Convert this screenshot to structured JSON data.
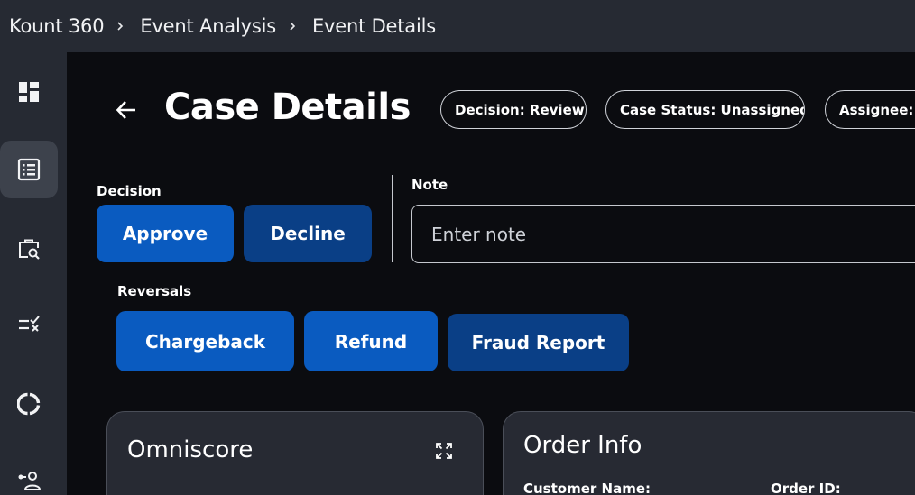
{
  "breadcrumb": {
    "items": [
      "Kount 360",
      "Event Analysis",
      "Event Details"
    ]
  },
  "sidebar": {
    "items": [
      {
        "icon": "dashboard-icon"
      },
      {
        "icon": "list-icon",
        "active": true
      },
      {
        "icon": "case-search-icon"
      },
      {
        "icon": "rules-check-icon"
      },
      {
        "icon": "donut-chart-icon"
      },
      {
        "icon": "user-flow-icon"
      }
    ]
  },
  "header": {
    "title": "Case Details",
    "pills": {
      "decision": "Decision: Review",
      "case_status": "Case Status: Unassigned",
      "assignee": "Assignee: Unassigned"
    }
  },
  "decision": {
    "label": "Decision",
    "approve": "Approve",
    "decline": "Decline"
  },
  "note": {
    "label": "Note",
    "placeholder": "Enter note"
  },
  "reversals": {
    "label": "Reversals",
    "chargeback": "Chargeback",
    "refund": "Refund",
    "fraud_report": "Fraud Report"
  },
  "omniscore_card": {
    "title": "Omniscore"
  },
  "order_info_card": {
    "title": "Order Info",
    "customer_name_label": "Customer Name:",
    "order_id_label": "Order ID:"
  },
  "colors": {
    "accent_primary": "#0a5bc0",
    "accent_dark": "#0a3f86",
    "chrome": "#262a33",
    "background": "#0b0c10"
  }
}
